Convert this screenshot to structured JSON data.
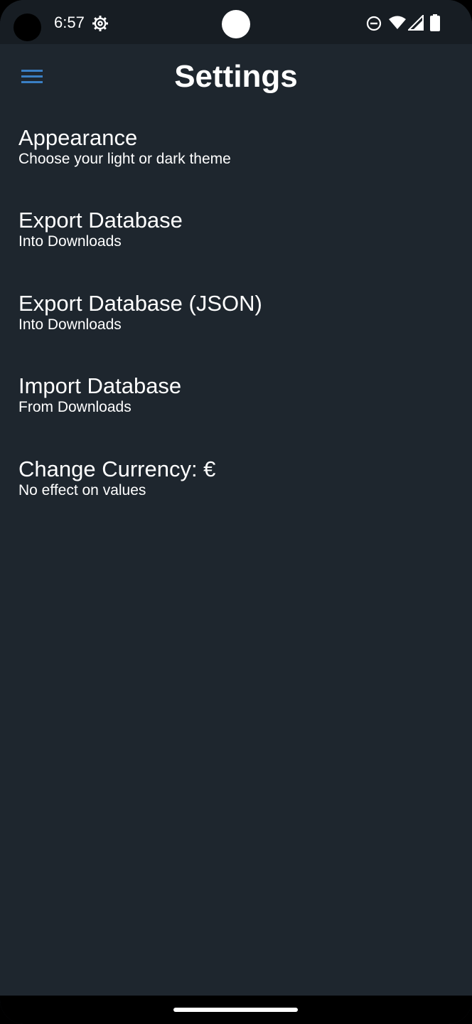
{
  "status_bar": {
    "time": "6:57",
    "icons": [
      "gear-icon",
      "do-not-disturb-icon",
      "wifi-icon",
      "signal-icon",
      "battery-icon"
    ]
  },
  "app_bar": {
    "title": "Settings",
    "menu_icon": "hamburger-menu-icon",
    "accent_color": "#3a7fc4"
  },
  "colors": {
    "background": "#1e262e",
    "status_bar_background": "#171d23",
    "text": "#ffffff"
  },
  "settings": {
    "items": [
      {
        "title": "Appearance",
        "subtitle": "Choose your light or dark theme"
      },
      {
        "title": "Export Database",
        "subtitle": "Into Downloads"
      },
      {
        "title": "Export Database (JSON)",
        "subtitle": "Into Downloads"
      },
      {
        "title": "Import Database",
        "subtitle": "From Downloads"
      },
      {
        "title": "Change Currency: €",
        "subtitle": "No effect on values"
      }
    ]
  }
}
